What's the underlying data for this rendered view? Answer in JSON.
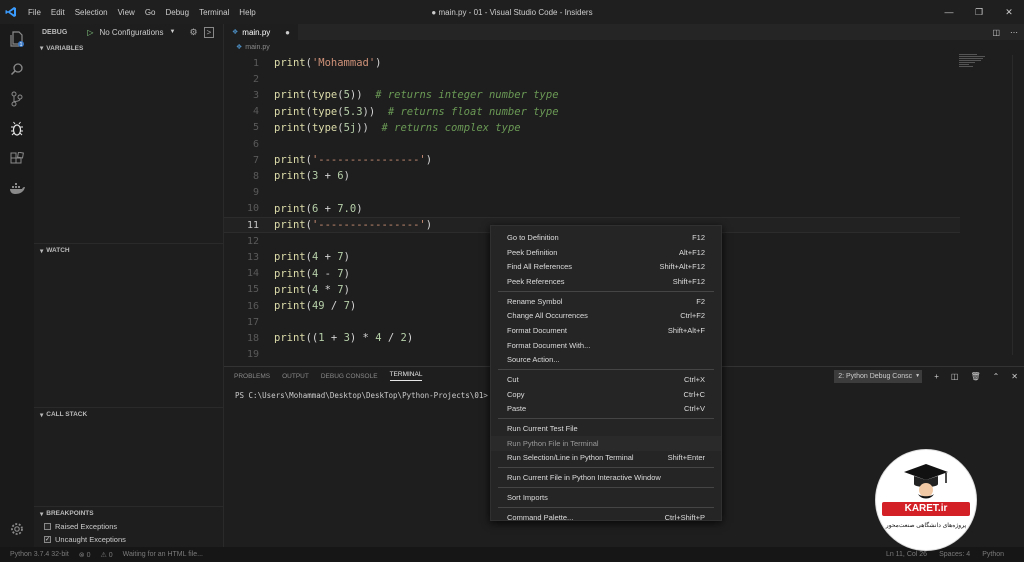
{
  "titlebar": {
    "menu": [
      "File",
      "Edit",
      "Selection",
      "View",
      "Go",
      "Debug",
      "Terminal",
      "Help"
    ],
    "title": "● main.py - 01 - Visual Studio Code - Insiders"
  },
  "sidebar": {
    "debug_label": "DEBUG",
    "config": "No Configurations",
    "sections": {
      "variables": "VARIABLES",
      "watch": "WATCH",
      "callstack": "CALL STACK",
      "breakpoints": "BREAKPOINTS"
    },
    "breakpoints": [
      {
        "label": "Raised Exceptions",
        "checked": false
      },
      {
        "label": "Uncaught Exceptions",
        "checked": true
      }
    ],
    "badge": "1"
  },
  "editor": {
    "tab": "main.py",
    "breadcrumb": "main.py",
    "current_line": 11,
    "lines": [
      {
        "n": "1",
        "html": "<span class=\"fn\">print</span>(<span class=\"str\">'Mohammad'</span>)"
      },
      {
        "n": "2",
        "html": ""
      },
      {
        "n": "3",
        "html": "<span class=\"fn\">print</span>(<span class=\"fn\">type</span>(<span class=\"num\">5</span>))  <span class=\"cmt\"># returns integer number type</span>"
      },
      {
        "n": "4",
        "html": "<span class=\"fn\">print</span>(<span class=\"fn\">type</span>(<span class=\"num\">5.3</span>))  <span class=\"cmt\"># returns float number type</span>"
      },
      {
        "n": "5",
        "html": "<span class=\"fn\">print</span>(<span class=\"fn\">type</span>(<span class=\"num\">5j</span>))  <span class=\"cmt\"># returns complex type</span>"
      },
      {
        "n": "6",
        "html": ""
      },
      {
        "n": "7",
        "html": "<span class=\"fn\">print</span>(<span class=\"str\">'----------------'</span>)"
      },
      {
        "n": "8",
        "html": "<span class=\"fn\">print</span>(<span class=\"num\">3</span> + <span class=\"num\">6</span>)"
      },
      {
        "n": "9",
        "html": ""
      },
      {
        "n": "10",
        "html": "<span class=\"fn\">print</span>(<span class=\"num\">6</span> + <span class=\"num\">7.0</span>)"
      },
      {
        "n": "11",
        "html": "<span class=\"fn\">print</span>(<span class=\"str\">'----------------'</span>)"
      },
      {
        "n": "12",
        "html": ""
      },
      {
        "n": "13",
        "html": "<span class=\"fn\">print</span>(<span class=\"num\">4</span> + <span class=\"num\">7</span>)"
      },
      {
        "n": "14",
        "html": "<span class=\"fn\">print</span>(<span class=\"num\">4</span> - <span class=\"num\">7</span>)"
      },
      {
        "n": "15",
        "html": "<span class=\"fn\">print</span>(<span class=\"num\">4</span> * <span class=\"num\">7</span>)"
      },
      {
        "n": "16",
        "html": "<span class=\"fn\">print</span>(<span class=\"num\">49</span> / <span class=\"num\">7</span>)"
      },
      {
        "n": "17",
        "html": ""
      },
      {
        "n": "18",
        "html": "<span class=\"fn\">print</span>((<span class=\"num\">1</span> + <span class=\"num\">3</span>) * <span class=\"num\">4</span> / <span class=\"num\">2</span>)"
      },
      {
        "n": "19",
        "html": ""
      }
    ]
  },
  "panel": {
    "tabs": [
      "PROBLEMS",
      "OUTPUT",
      "DEBUG CONSOLE",
      "TERMINAL"
    ],
    "active_tab": "TERMINAL",
    "terminal_select": "2: Python Debug Consc",
    "terminal_line": "PS C:\\Users\\Mohammad\\Desktop\\DeskTop\\Python-Projects\\01>"
  },
  "statusbar": {
    "python": "Python 3.7.4 32-bit",
    "errors": "⊗ 0",
    "warnings": "⚠ 0",
    "waiting": "Waiting for an HTML file...",
    "position": "Ln 11, Col 26",
    "spaces": "Spaces: 4",
    "lang": "Python"
  },
  "context_menu": {
    "groups": [
      [
        {
          "label": "Go to Definition",
          "key": "F12"
        },
        {
          "label": "Peek Definition",
          "key": "Alt+F12"
        },
        {
          "label": "Find All References",
          "key": "Shift+Alt+F12"
        },
        {
          "label": "Peek References",
          "key": "Shift+F12"
        }
      ],
      [
        {
          "label": "Rename Symbol",
          "key": "F2"
        },
        {
          "label": "Change All Occurrences",
          "key": "Ctrl+F2"
        },
        {
          "label": "Format Document",
          "key": "Shift+Alt+F"
        },
        {
          "label": "Format Document With...",
          "key": ""
        },
        {
          "label": "Source Action...",
          "key": ""
        }
      ],
      [
        {
          "label": "Cut",
          "key": "Ctrl+X"
        },
        {
          "label": "Copy",
          "key": "Ctrl+C"
        },
        {
          "label": "Paste",
          "key": "Ctrl+V"
        }
      ],
      [
        {
          "label": "Run Current Test File",
          "key": ""
        },
        {
          "label": "Run Python File in Terminal",
          "key": "",
          "hover": true
        },
        {
          "label": "Run Selection/Line in Python Terminal",
          "key": "Shift+Enter"
        }
      ],
      [
        {
          "label": "Run Current File in Python Interactive Window",
          "key": ""
        }
      ],
      [
        {
          "label": "Sort Imports",
          "key": ""
        }
      ],
      [
        {
          "label": "Command Palette...",
          "key": "Ctrl+Shift+P"
        }
      ]
    ]
  },
  "logo": {
    "name": "KARET.ir",
    "tagline": "پروژه‌های دانشگاهی صنعت‌محور"
  },
  "colors": {
    "background": "#1e1e1e",
    "keyword_fn": "#dcdcaa",
    "string": "#ce9178",
    "number": "#b5cea8",
    "comment": "#6a9955",
    "logo_red": "#d32027"
  }
}
